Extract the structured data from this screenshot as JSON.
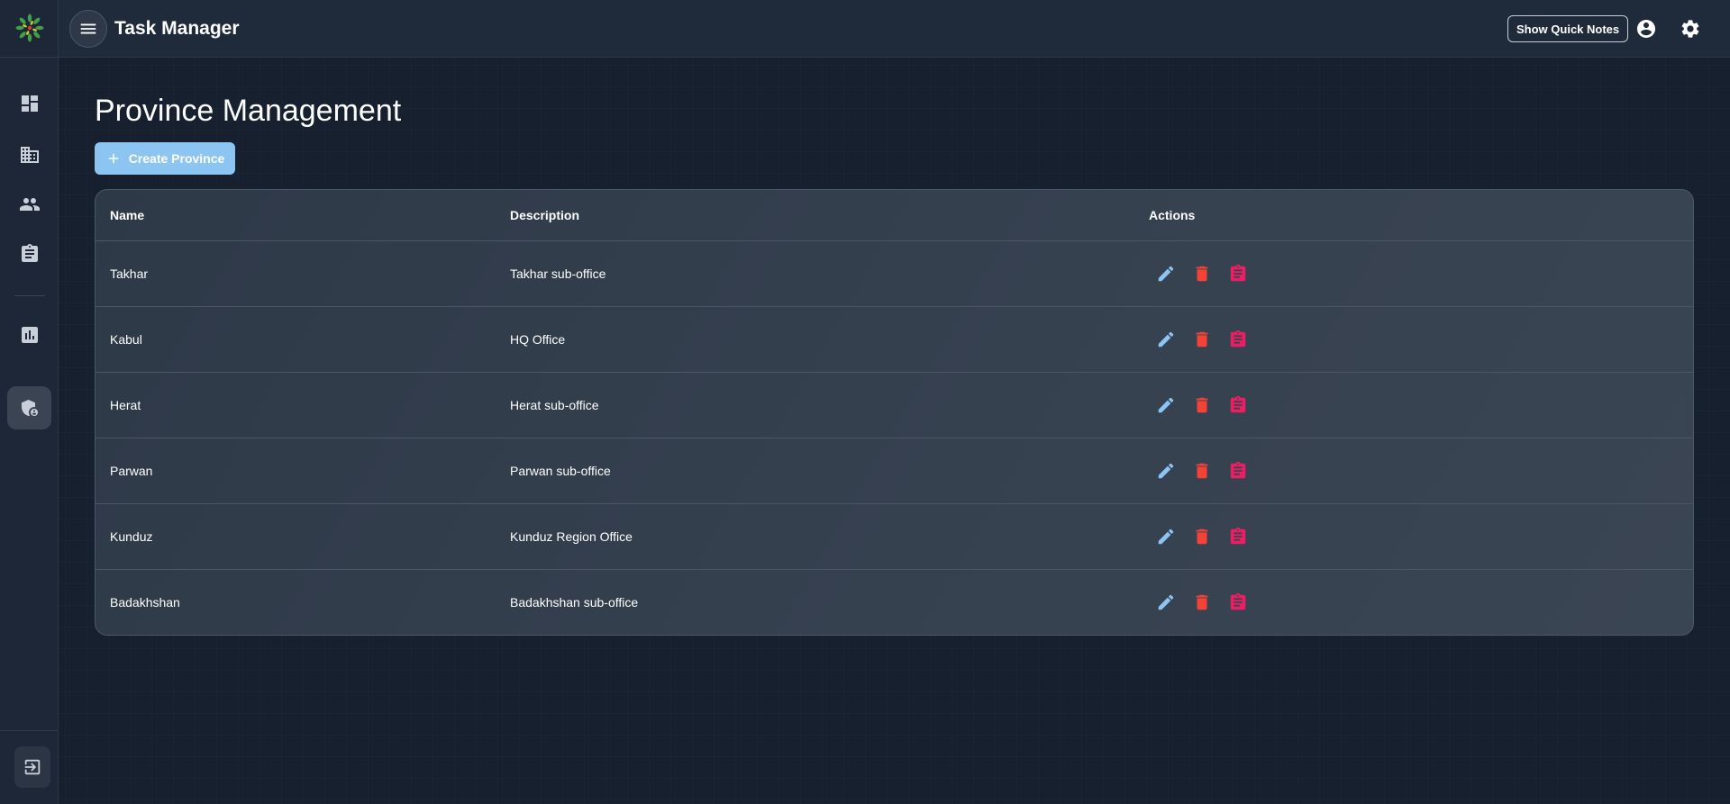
{
  "app": {
    "title": "Task Manager"
  },
  "header": {
    "quick_notes_label": "Show Quick Notes",
    "icons": [
      "menu-icon",
      "account-circle-icon",
      "settings-gear-icon"
    ]
  },
  "sidebar": {
    "items": [
      {
        "name": "dashboard",
        "icon": "dashboard-icon",
        "active": false
      },
      {
        "name": "organizations",
        "icon": "building-icon",
        "active": false
      },
      {
        "name": "users",
        "icon": "people-icon",
        "active": false
      },
      {
        "name": "tasks",
        "icon": "clipboard-icon",
        "active": false
      },
      {
        "name": "reports",
        "icon": "bar-chart-icon",
        "active": false
      },
      {
        "name": "admin",
        "icon": "admin-shield-icon",
        "active": true
      }
    ],
    "logout_icon": "logout-icon"
  },
  "page": {
    "title": "Province Management",
    "create_button_label": "Create Province"
  },
  "table": {
    "headers": {
      "name": "Name",
      "description": "Description",
      "actions": "Actions"
    },
    "rows": [
      {
        "name": "Takhar",
        "description": "Takhar sub-office"
      },
      {
        "name": "Kabul",
        "description": "HQ Office"
      },
      {
        "name": "Herat",
        "description": "Herat sub-office"
      },
      {
        "name": "Parwan",
        "description": "Parwan sub-office"
      },
      {
        "name": "Kunduz",
        "description": "Kunduz Region Office"
      },
      {
        "name": "Badakhshan",
        "description": "Badakhshan sub-office"
      }
    ],
    "action_icons": [
      "edit-pencil-icon",
      "delete-trash-icon",
      "assignment-icon"
    ]
  },
  "colors": {
    "accent_blue": "#8cc4f2",
    "delete_red": "#f44336",
    "assign_pink": "#e91e63",
    "background": "#17202f"
  }
}
